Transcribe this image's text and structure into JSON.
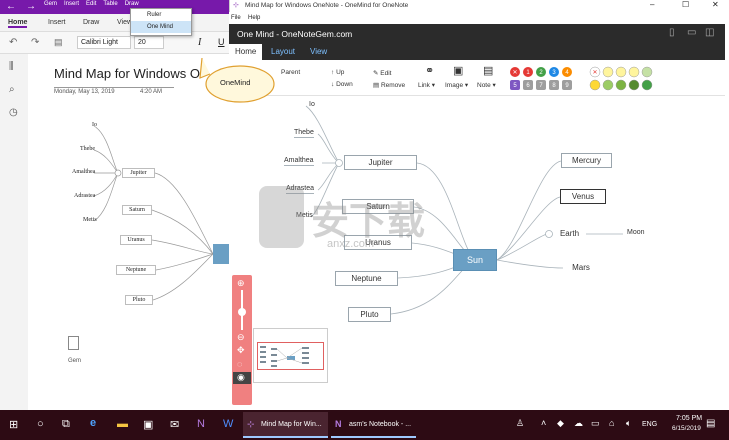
{
  "onenote": {
    "menu": [
      "Gem",
      "Insert",
      "Edit",
      "Table",
      "Draw"
    ],
    "tabs": [
      "Home",
      "Insert",
      "Draw",
      "View"
    ],
    "font": "Calibri Light",
    "font_size": "20",
    "page_title": "Mind Map for Windows O",
    "date": "Monday, May 13, 2019",
    "time": "4:20 AM",
    "nodes": [
      "Jupiter",
      "Saturn",
      "Uranus",
      "Neptune",
      "Pluto"
    ],
    "leaves": [
      "Io",
      "Thebe",
      "Amalthea",
      "Adrastea",
      "Metis"
    ],
    "attachment_label": "Gem"
  },
  "dropdown": {
    "items": [
      "Ruler",
      "One Mind"
    ]
  },
  "callout": "OneMind",
  "onemind": {
    "window_title": "Mind Map for Windows OneNote - OneMind for OneNote",
    "menu": [
      "File",
      "Help"
    ],
    "header": "One Mind - OneNoteGem.com",
    "tabs": [
      "Home",
      "Layout",
      "View"
    ],
    "toolbar": {
      "parent": "Parent",
      "up": "Up",
      "down": "Down",
      "edit": "Edit",
      "remove": "Remove",
      "link": "Link",
      "image": "Image",
      "note": "Note"
    },
    "center": "Sun",
    "left_nodes": [
      "Jupiter",
      "Saturn",
      "Uranus",
      "Neptune",
      "Pluto"
    ],
    "jupiter_leaves": [
      "Io",
      "Thebe",
      "Amalthea",
      "Adrastea",
      "Metis"
    ],
    "right_nodes": [
      "Mercury",
      "Venus",
      "Earth",
      "Mars"
    ],
    "earth_leaf": "Moon",
    "watermark": "anxz.com"
  },
  "taskbar": {
    "tasks": [
      "Mind Map for Win...",
      "asm's Notebook - ..."
    ],
    "time": "7:05 PM",
    "date": "6/15/2019",
    "lang": "ENG"
  },
  "colors": {
    "onenote_purple": "#7719aa",
    "sun_fill": "#6a9fc4",
    "zoom_panel": "#f08080",
    "taskbar": "#2d0b14"
  }
}
